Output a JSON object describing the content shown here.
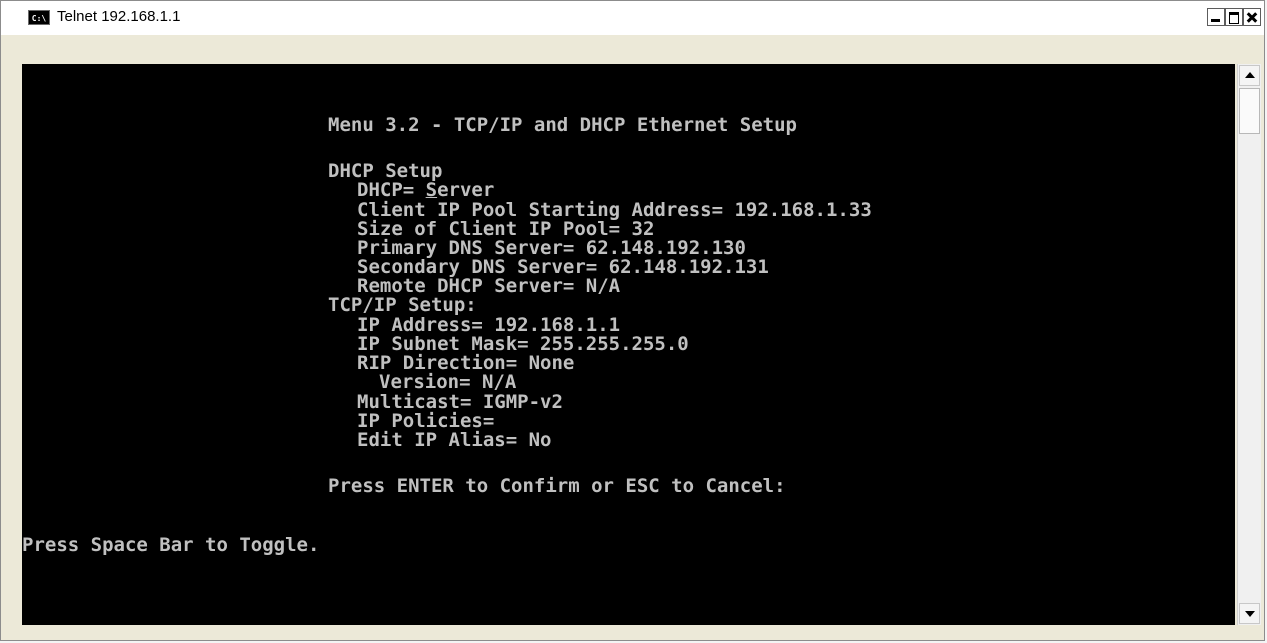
{
  "window": {
    "title": "Telnet 192.168.1.1",
    "icon_text": "C:\\"
  },
  "console": {
    "menu_title": "Menu 3.2 - TCP/IP and DHCP Ethernet Setup",
    "dhcp_setup_header": "DHCP Setup",
    "dhcp_label": "DHCP= ",
    "dhcp_value_first": "S",
    "dhcp_value_rest": "erver",
    "client_ip_pool_start": "Client IP Pool Starting Address= 192.168.1.33",
    "client_ip_pool_size": "Size of Client IP Pool= 32",
    "primary_dns": "Primary DNS Server= 62.148.192.130",
    "secondary_dns": "Secondary DNS Server= 62.148.192.131",
    "remote_dhcp": "Remote DHCP Server= N/A",
    "tcpip_setup_header": "TCP/IP Setup:",
    "ip_address": "IP Address= 192.168.1.1",
    "ip_subnet_mask": "IP Subnet Mask= 255.255.255.0",
    "rip_direction": "RIP Direction= None",
    "rip_version": "Version= N/A",
    "multicast": "Multicast= IGMP-v2",
    "ip_policies": "IP Policies=",
    "edit_ip_alias": "Edit IP Alias= No",
    "confirm_prompt": "Press ENTER to Confirm or ESC to Cancel:",
    "toggle_hint": "Press Space Bar to Toggle."
  },
  "colors": {
    "console_bg": "#000000",
    "console_fg": "#c0c0c0"
  }
}
